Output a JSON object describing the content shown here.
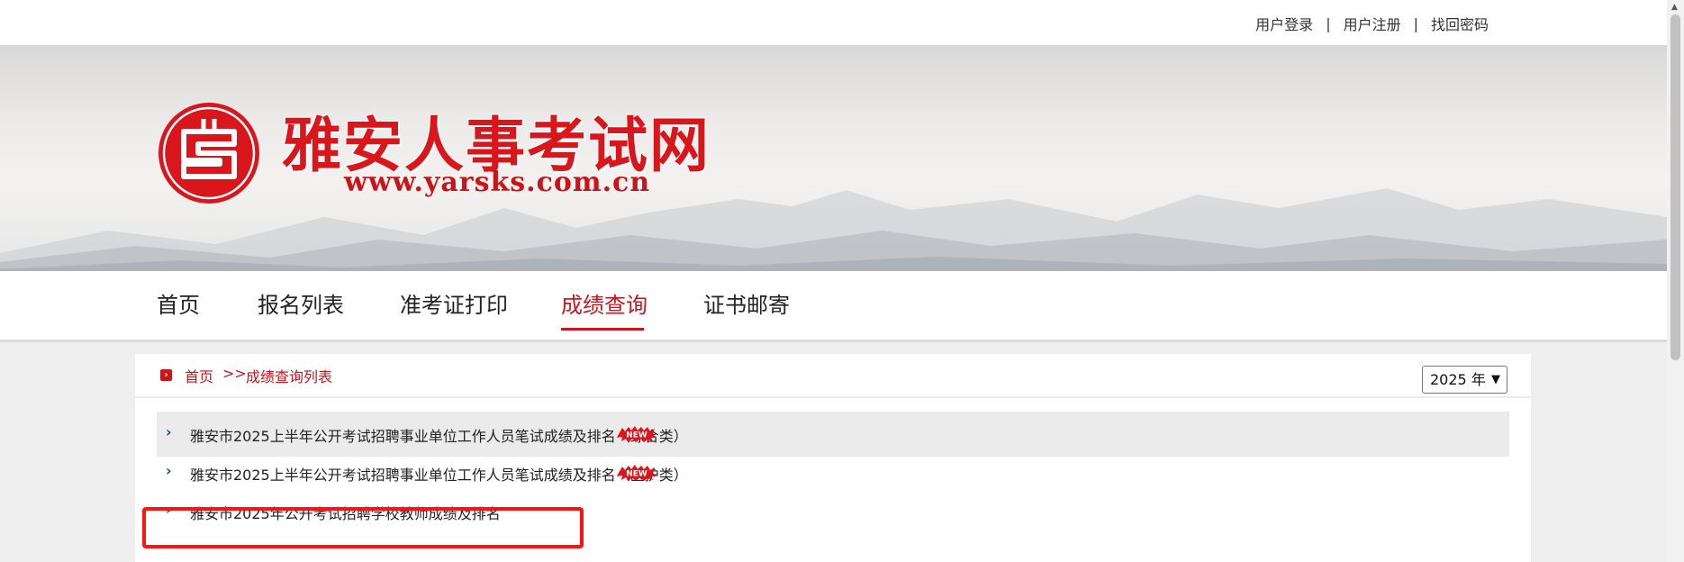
{
  "top_links": {
    "login": "用户登录",
    "register": "用户注册",
    "recover": "找回密码",
    "separator": "|"
  },
  "logo": {
    "title": "雅安人事考试网",
    "url": "www.yarsks.com.cn"
  },
  "nav": {
    "items": [
      "首页",
      "报名列表",
      "准考证打印",
      "成绩查询",
      "证书邮寄"
    ],
    "active": "成绩查询"
  },
  "breadcrumb": {
    "home": "首页",
    "separator": ">>",
    "current": "成绩查询列表"
  },
  "year_select": {
    "value": "2025 年"
  },
  "list": [
    {
      "title": "雅安市2025上半年公开考试招聘事业单位工作人员笔试成绩及排名（综合类）",
      "is_new": true
    },
    {
      "title": "雅安市2025上半年公开考试招聘事业单位工作人员笔试成绩及排名（医护类）",
      "is_new": true
    },
    {
      "title": "雅安市2025年公开考试招聘学校教师成绩及排名",
      "is_new": false
    }
  ],
  "badge_text": "NEW",
  "colors": {
    "brand_red": "#c8161d",
    "highlight_red": "#ff1212",
    "chevron_blue": "#1d4f7a"
  }
}
